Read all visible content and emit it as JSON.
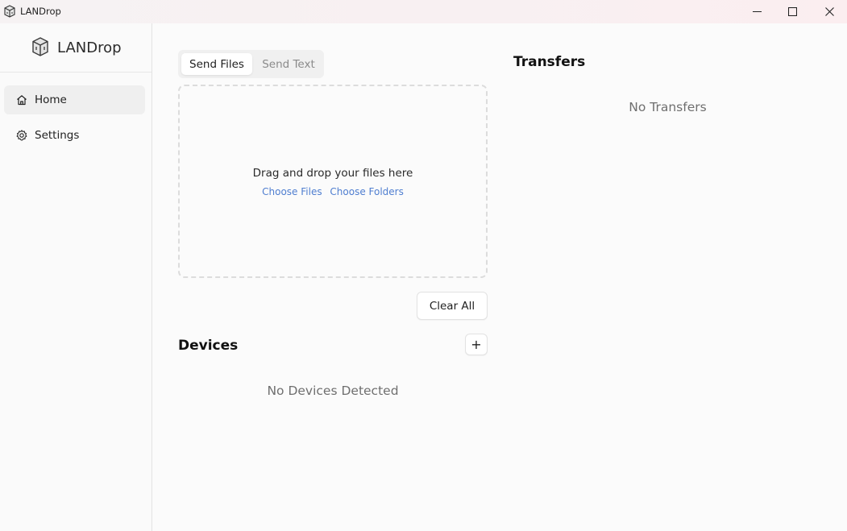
{
  "window": {
    "title": "LANDrop",
    "minimize_glyph": "—",
    "maximize_glyph": "☐",
    "close_glyph": "✕"
  },
  "sidebar": {
    "brand": "LANDrop",
    "items": [
      {
        "label": "Home",
        "icon": "home-icon",
        "active": true
      },
      {
        "label": "Settings",
        "icon": "gear-icon",
        "active": false
      }
    ]
  },
  "send": {
    "tabs": [
      {
        "label": "Send Files",
        "active": true
      },
      {
        "label": "Send Text",
        "active": false
      }
    ],
    "dropzone_text": "Drag and drop your files here",
    "choose_files": "Choose Files",
    "choose_folders": "Choose Folders",
    "clear_all": "Clear All"
  },
  "devices": {
    "title": "Devices",
    "add_glyph": "+",
    "empty": "No Devices Detected"
  },
  "transfers": {
    "title": "Transfers",
    "empty": "No Transfers"
  },
  "colors": {
    "link": "#4f7ed0",
    "active_nav": "#efefef",
    "titlebar_tint": "#fbeef0"
  }
}
